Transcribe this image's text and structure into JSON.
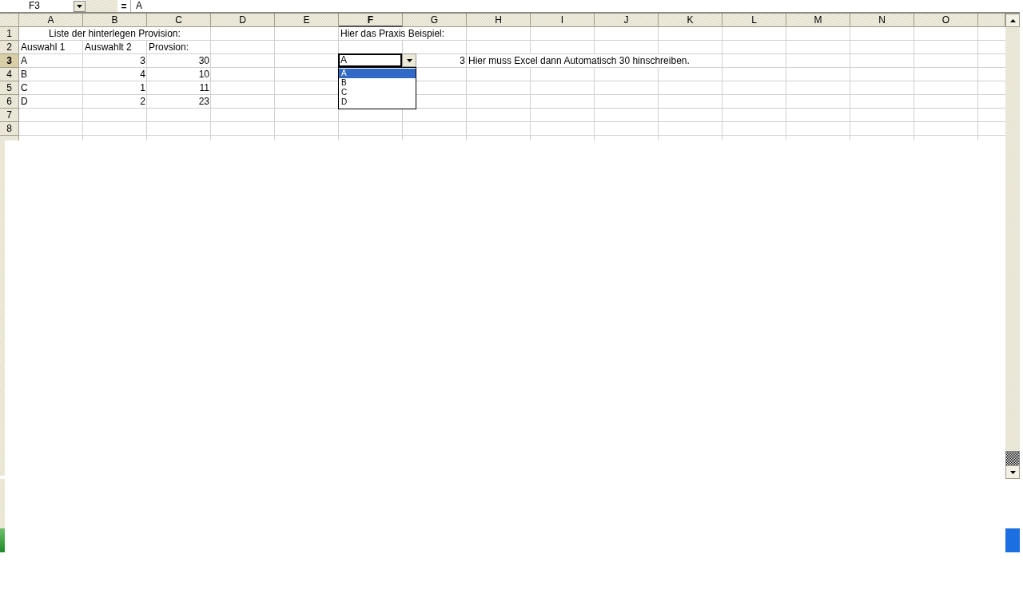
{
  "formula_bar": {
    "cell_reference": "F3",
    "equals": "=",
    "content": "A"
  },
  "columns": [
    {
      "label": "A",
      "selected": false
    },
    {
      "label": "B",
      "selected": false
    },
    {
      "label": "C",
      "selected": false
    },
    {
      "label": "D",
      "selected": false
    },
    {
      "label": "E",
      "selected": false
    },
    {
      "label": "F",
      "selected": true
    },
    {
      "label": "G",
      "selected": false
    },
    {
      "label": "H",
      "selected": false
    },
    {
      "label": "I",
      "selected": false
    },
    {
      "label": "J",
      "selected": false
    },
    {
      "label": "K",
      "selected": false
    },
    {
      "label": "L",
      "selected": false
    },
    {
      "label": "M",
      "selected": false
    },
    {
      "label": "N",
      "selected": false
    },
    {
      "label": "O",
      "selected": false
    }
  ],
  "rows": [
    {
      "number": "1",
      "selected": false,
      "cells": [
        {
          "kind": "merged-title",
          "text": "Liste der hinterlegen Provision:"
        },
        null,
        null,
        {
          "kind": "wide-text",
          "text": "Hier das Praxis Beispiel:"
        }
      ]
    },
    {
      "number": "2",
      "selected": false,
      "cells": [
        {
          "kind": "text",
          "text": "Auswahl 1"
        },
        {
          "kind": "text",
          "text": "Auswahlt 2"
        },
        {
          "kind": "text",
          "text": "Provsion:"
        }
      ]
    },
    {
      "number": "3",
      "selected": true,
      "cells": [
        {
          "kind": "text",
          "text": "A"
        },
        {
          "kind": "number",
          "text": "3"
        },
        {
          "kind": "number",
          "text": "30"
        },
        null,
        null,
        {
          "kind": "dropdown",
          "value": "A",
          "options": [
            {
              "label": "A",
              "selected": true
            },
            {
              "label": "B",
              "selected": false
            },
            {
              "label": "C",
              "selected": false
            },
            {
              "label": "D",
              "selected": false
            }
          ]
        },
        {
          "kind": "number",
          "text": "3"
        },
        {
          "kind": "overflow",
          "text": "Hier muss Excel dann Automatisch 30 hinschreiben."
        }
      ]
    },
    {
      "number": "4",
      "selected": false,
      "cells": [
        {
          "kind": "text",
          "text": "B"
        },
        {
          "kind": "number",
          "text": "4"
        },
        {
          "kind": "number",
          "text": "10"
        }
      ]
    },
    {
      "number": "5",
      "selected": false,
      "cells": [
        {
          "kind": "text",
          "text": "C"
        },
        {
          "kind": "number",
          "text": "1"
        },
        {
          "kind": "number",
          "text": "11"
        }
      ]
    },
    {
      "number": "6",
      "selected": false,
      "cells": [
        {
          "kind": "text",
          "text": "D"
        },
        {
          "kind": "number",
          "text": "2"
        },
        {
          "kind": "number",
          "text": "23"
        }
      ]
    },
    {
      "number": "7",
      "selected": false,
      "cells": []
    },
    {
      "number": "8",
      "selected": false,
      "cells": []
    }
  ]
}
